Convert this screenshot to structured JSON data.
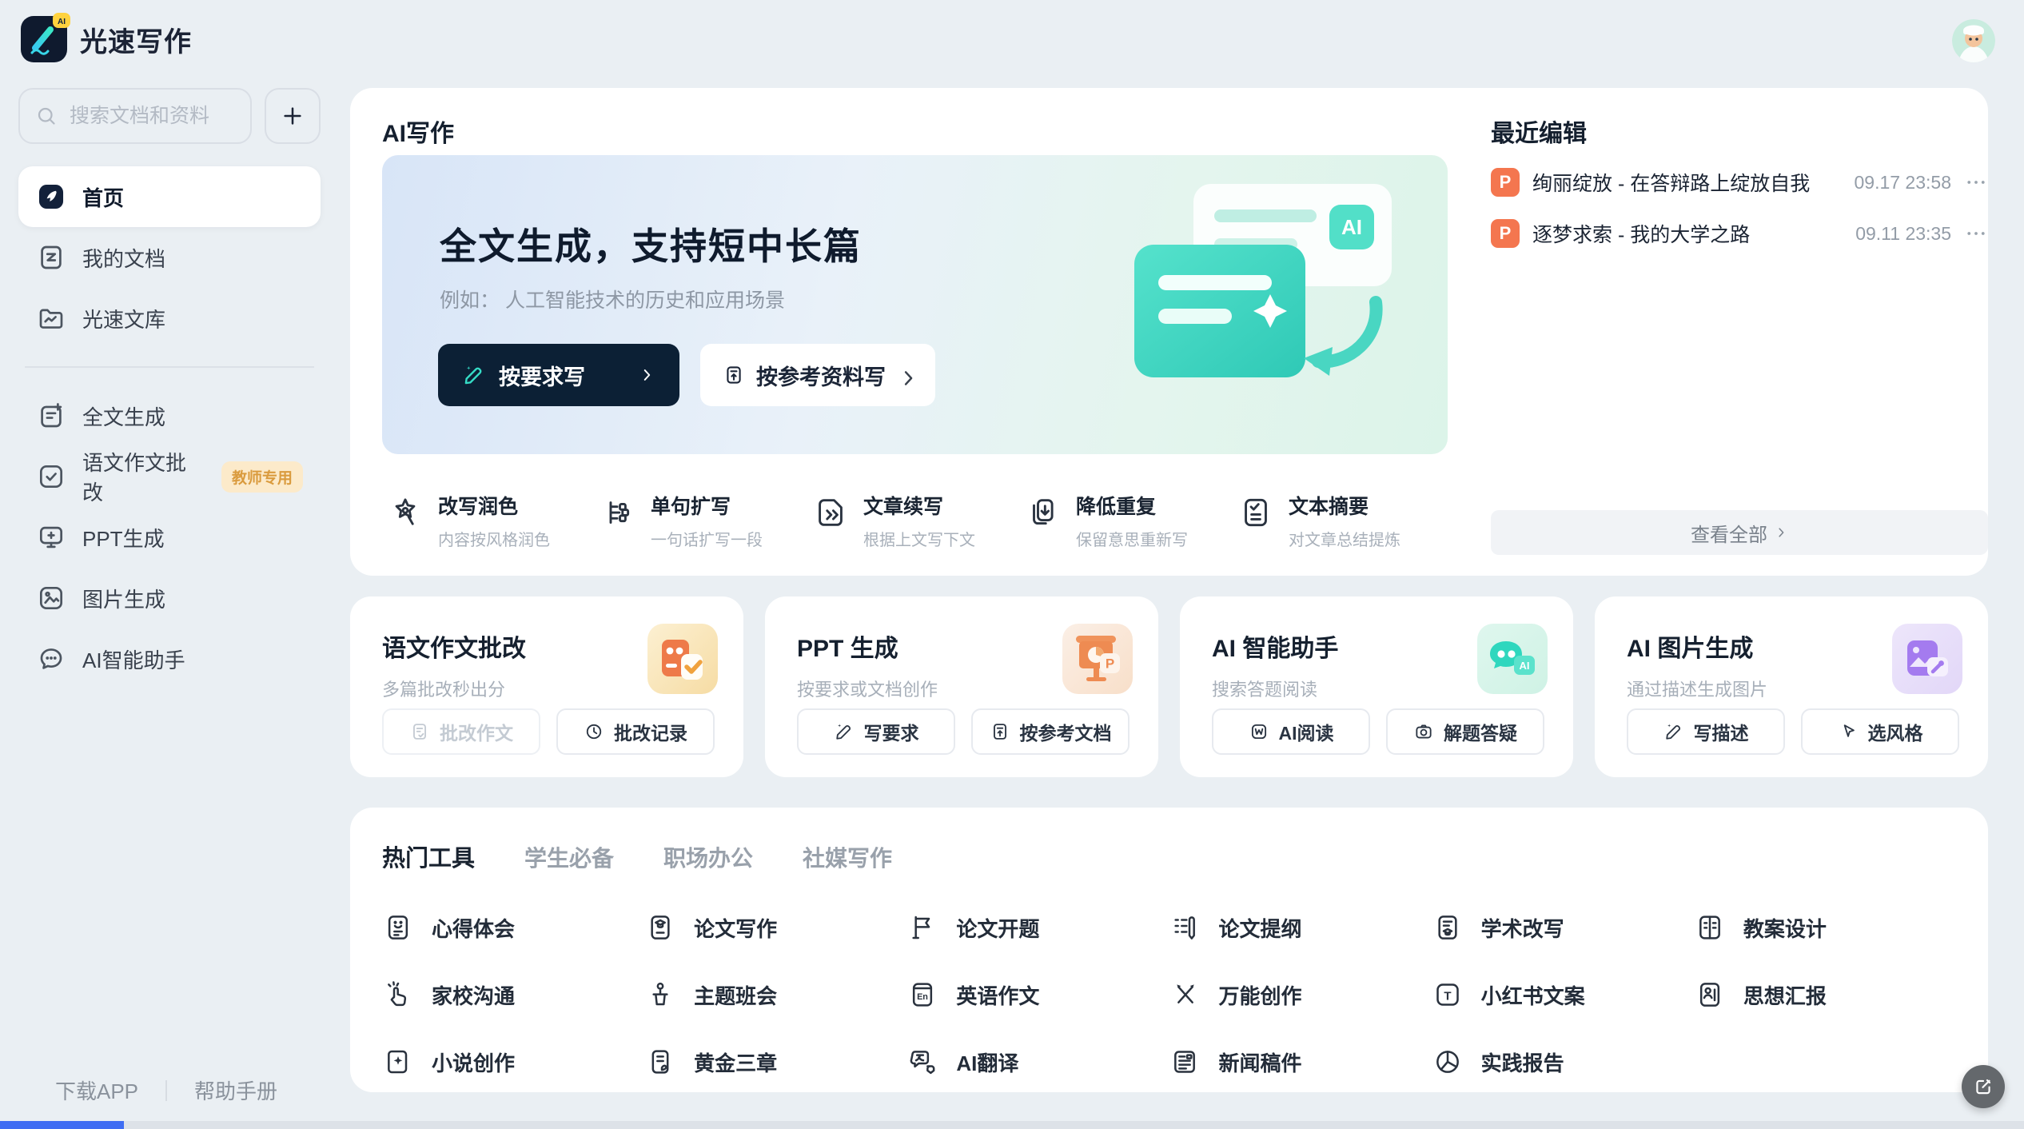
{
  "app": {
    "name": "光速写作"
  },
  "colors": {
    "accent_teal": "#35DCC6",
    "navy": "#0C2035",
    "orange_file": "#F4764F",
    "badge_bg": "#FCEACA",
    "badge_text": "#DA9B3E",
    "page_bg": "#EAEFF3"
  },
  "sidebar": {
    "search_placeholder": "搜索文档和资料",
    "items": [
      {
        "label": "首页",
        "icon": "home",
        "active": true
      },
      {
        "label": "我的文档",
        "icon": "doc"
      },
      {
        "label": "光速文库",
        "icon": "library",
        "divider_after": true
      },
      {
        "label": "全文生成",
        "icon": "doc-plus"
      },
      {
        "label": "语文作文批改",
        "icon": "check-square",
        "badge": "教师专用"
      },
      {
        "label": "PPT生成",
        "icon": "monitor"
      },
      {
        "label": "图片生成",
        "icon": "image"
      },
      {
        "label": "AI智能助手",
        "icon": "chat"
      }
    ],
    "footer": [
      "下载APP",
      "帮助手册"
    ]
  },
  "ai_writing": {
    "section_title": "AI写作",
    "hero": {
      "title": "全文生成，支持短中长篇",
      "example": "例如： 人工智能技术的历史和应用场景",
      "primary_button": "按要求写",
      "secondary_button": "按参考资料写",
      "illustration_badge": "AI"
    },
    "features": [
      {
        "title": "改写润色",
        "subtitle": "内容按风格润色",
        "icon": "polish"
      },
      {
        "title": "单句扩写",
        "subtitle": "一句话扩写一段",
        "icon": "expand"
      },
      {
        "title": "文章续写",
        "subtitle": "根据上文写下文",
        "icon": "continue"
      },
      {
        "title": "降低重复",
        "subtitle": "保留意思重新写",
        "icon": "dedupe"
      },
      {
        "title": "文本摘要",
        "subtitle": "对文章总结提炼",
        "icon": "summary"
      }
    ]
  },
  "recent": {
    "title": "最近编辑",
    "docs": [
      {
        "title": "绚丽绽放 - 在答辩路上绽放自我",
        "time": "09.17 23:58",
        "file_icon": "P"
      },
      {
        "title": "逐梦求索 - 我的大学之路",
        "time": "09.11 23:35",
        "file_icon": "P"
      }
    ],
    "view_all": "查看全部"
  },
  "cards": [
    {
      "title": "语文作文批改",
      "subtitle": "多篇批改秒出分",
      "illustration": "essay-grading",
      "buttons": [
        {
          "label": "批改作文",
          "icon": "doc-check",
          "disabled": true
        },
        {
          "label": "批改记录",
          "icon": "clock"
        }
      ]
    },
    {
      "title": "PPT 生成",
      "subtitle": "按要求或文档创作",
      "illustration": "ppt",
      "buttons": [
        {
          "label": "写要求",
          "icon": "pen"
        },
        {
          "label": "按参考文档",
          "icon": "doc-upload"
        }
      ]
    },
    {
      "title": "AI 智能助手",
      "subtitle": "搜索答题阅读",
      "illustration": "assistant",
      "buttons": [
        {
          "label": "AI阅读",
          "icon": "w-read"
        },
        {
          "label": "解题答疑",
          "icon": "camera"
        }
      ]
    },
    {
      "title": "AI 图片生成",
      "subtitle": "通过描述生成图片",
      "illustration": "image-gen",
      "buttons": [
        {
          "label": "写描述",
          "icon": "pen"
        },
        {
          "label": "选风格",
          "icon": "style"
        }
      ]
    }
  ],
  "tools": {
    "tabs": [
      {
        "label": "热门工具",
        "active": true
      },
      {
        "label": "学生必备"
      },
      {
        "label": "职场办公"
      },
      {
        "label": "社媒写作"
      }
    ],
    "items": [
      {
        "label": "心得体会",
        "icon": "smiley-doc"
      },
      {
        "label": "论文写作",
        "icon": "thesis"
      },
      {
        "label": "论文开题",
        "icon": "flag"
      },
      {
        "label": "论文提纲",
        "icon": "outline"
      },
      {
        "label": "学术改写",
        "icon": "academic"
      },
      {
        "label": "教案设计",
        "icon": "lesson"
      },
      {
        "label": "家校沟通",
        "icon": "hand"
      },
      {
        "label": "主题班会",
        "icon": "podium"
      },
      {
        "label": "英语作文",
        "icon": "en-book"
      },
      {
        "label": "万能创作",
        "icon": "cross-pens"
      },
      {
        "label": "小红书文案",
        "icon": "xhs"
      },
      {
        "label": "思想汇报",
        "icon": "person-doc"
      },
      {
        "label": "小说创作",
        "icon": "novel"
      },
      {
        "label": "黄金三章",
        "icon": "golden"
      },
      {
        "label": "AI翻译",
        "icon": "translate"
      },
      {
        "label": "新闻稿件",
        "icon": "news"
      },
      {
        "label": "实践报告",
        "icon": "report"
      }
    ]
  }
}
